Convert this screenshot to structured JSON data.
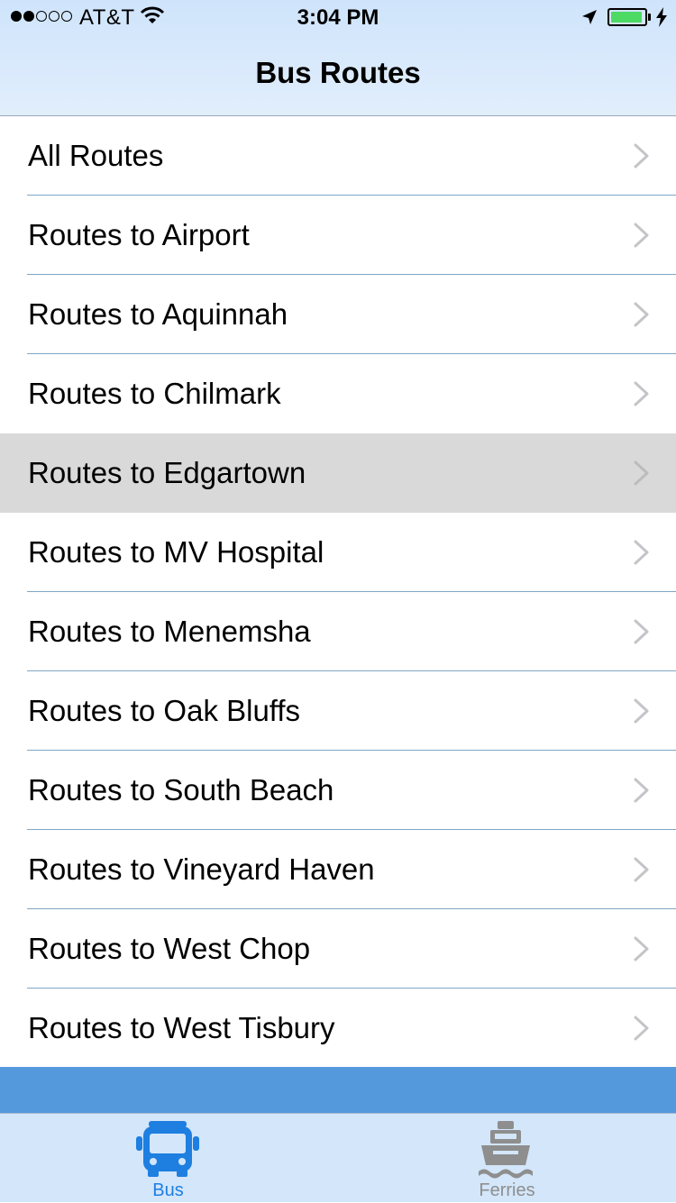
{
  "status_bar": {
    "carrier": "AT&T",
    "time": "3:04 PM",
    "signal_filled": 2,
    "signal_total": 5,
    "battery_level": 0.95
  },
  "nav": {
    "title": "Bus Routes"
  },
  "routes": [
    {
      "label": "All Routes"
    },
    {
      "label": "Routes to Airport"
    },
    {
      "label": "Routes to Aquinnah"
    },
    {
      "label": "Routes to Chilmark"
    },
    {
      "label": "Routes to Edgartown",
      "selected": true
    },
    {
      "label": "Routes to MV Hospital"
    },
    {
      "label": "Routes to Menemsha"
    },
    {
      "label": "Routes to Oak Bluffs"
    },
    {
      "label": "Routes to South Beach"
    },
    {
      "label": "Routes to Vineyard Haven"
    },
    {
      "label": "Routes to West Chop"
    },
    {
      "label": "Routes to West Tisbury"
    }
  ],
  "tabs": [
    {
      "label": "Bus",
      "icon": "bus-icon",
      "active": true
    },
    {
      "label": "Ferries",
      "icon": "ferry-icon",
      "active": false
    }
  ],
  "colors": {
    "tab_active": "#1e7fe0",
    "tab_inactive": "#8e8e8e",
    "selected_row": "#d9d9d9",
    "battery": "#4cd964",
    "band": "#5599dd"
  }
}
